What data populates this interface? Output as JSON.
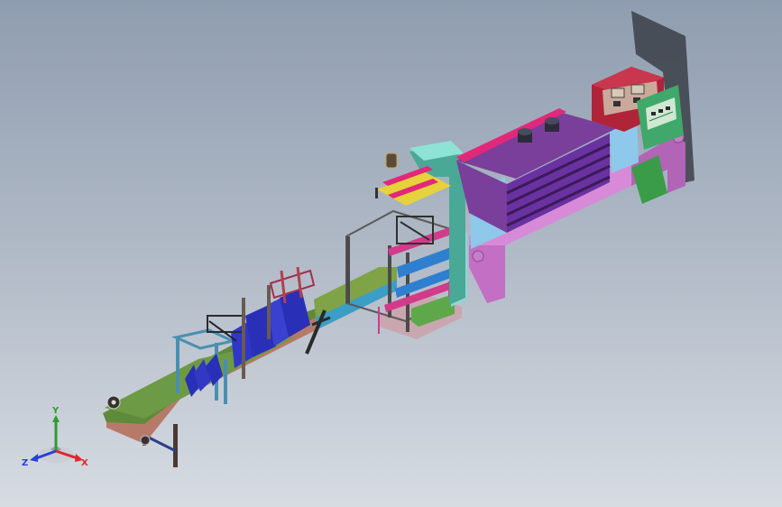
{
  "viewport": {
    "background_top": "#8f9db0",
    "background_bottom": "#d7dce3"
  },
  "triad": {
    "x_label": "X",
    "y_label": "Y",
    "z_label": "Z",
    "x_color": "#e0262b",
    "y_color": "#2e9c2e",
    "z_color": "#2a3fd8"
  },
  "model": {
    "conveyor_belt_color": "#5e8a3a",
    "conveyor_frame_color": "#b87a68",
    "guide_blue_color": "#2a2fb8",
    "tunnel_roof_color": "#7a3f9a",
    "tunnel_frame_color": "#d78ad8",
    "tunnel_fan_color": "#2b2b3a",
    "control_box_color": "#b0243a",
    "panel_green_color": "#3fa86a",
    "teal_column_color": "#4aa896",
    "cyan_color": "#8fd6d8",
    "magenta_color": "#e2287a",
    "yellow_color": "#e6d23a"
  }
}
